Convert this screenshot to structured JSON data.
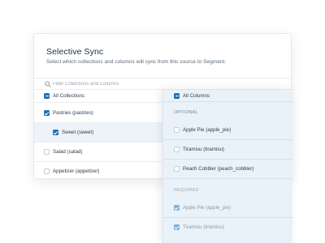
{
  "dialog": {
    "title": "Selective Sync",
    "description": "Select which collections and columns will sync from this source to Segment."
  },
  "search": {
    "placeholder": "Filter Collections and Columns",
    "icon": "search-icon"
  },
  "collections": {
    "header_label": "All Collections",
    "header_state": "partial",
    "items": [
      {
        "label": "Pastries (pastries)",
        "state": "checked"
      },
      {
        "label": "Sweet (sweet)",
        "state": "checked",
        "nested": true,
        "selected": true
      },
      {
        "label": "Salad (salad)",
        "state": "unchecked"
      },
      {
        "label": "Appetizer (appetizer)",
        "state": "unchecked"
      }
    ]
  },
  "columns": {
    "header_label": "All Columns",
    "header_state": "partial",
    "optional_label": "OPTIONAL",
    "optional": [
      {
        "label": "Apple Pie (apple_pie)",
        "state": "unchecked"
      },
      {
        "label": "Tiramisu (tiramisu)",
        "state": "unchecked"
      },
      {
        "label": "Peach Cobbler (peach_cobbler)",
        "state": "unchecked"
      }
    ],
    "required_label": "REQUIRED",
    "required": [
      {
        "label": "Apple Pie (apple_pie)",
        "state": "checked"
      },
      {
        "label": "Tiramisu (tiramisu)",
        "state": "checked"
      }
    ]
  },
  "colors": {
    "accent": "#1a6fbd",
    "panel_bg": "#eaf2f9",
    "selected_row_bg": "#edf3f9"
  }
}
